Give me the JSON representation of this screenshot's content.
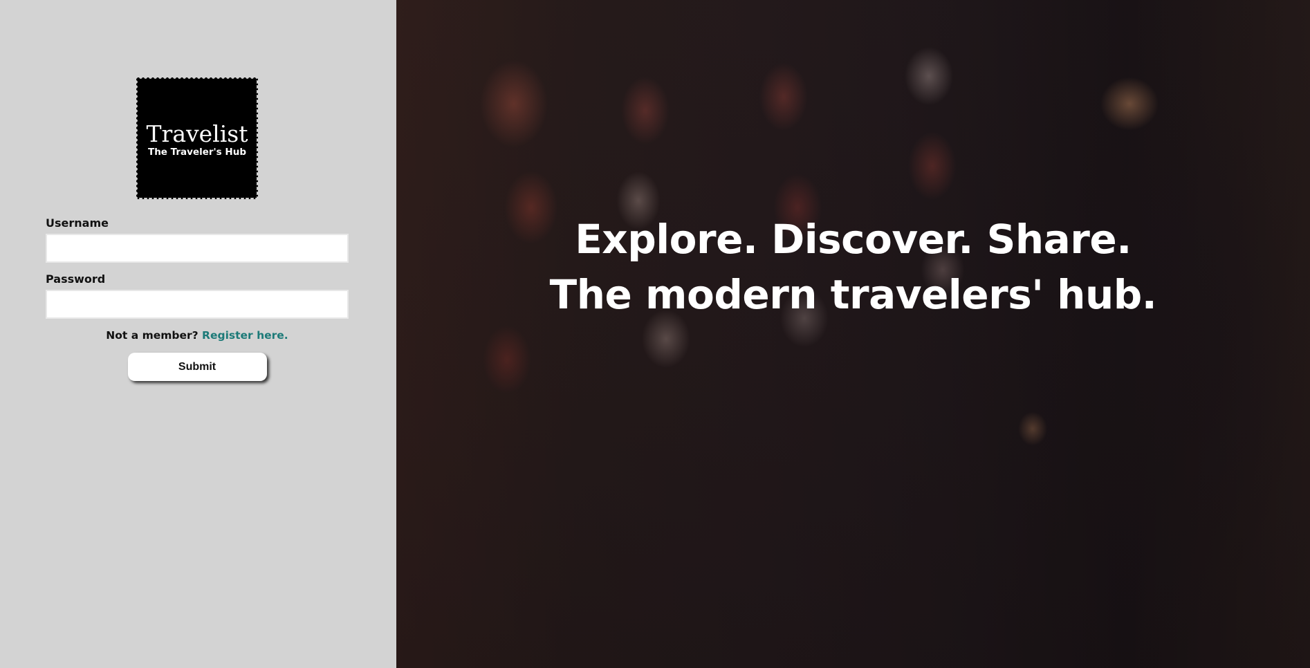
{
  "logo": {
    "title": "Travelist",
    "subtitle": "The Traveler's Hub",
    "background": "#000000"
  },
  "login": {
    "username_label": "Username",
    "username_value": "",
    "username_placeholder": "",
    "password_label": "Password",
    "password_value": "",
    "password_placeholder": "",
    "register_prompt": "Not a member?",
    "register_link": "Register here.",
    "submit_label": "Submit"
  },
  "hero": {
    "line1": "Explore. Discover. Share.",
    "line2": "The modern travelers' hub."
  },
  "colors": {
    "panel_bg": "#d3d3d3",
    "link": "#1c7a78",
    "hero_text": "#ffffff"
  }
}
